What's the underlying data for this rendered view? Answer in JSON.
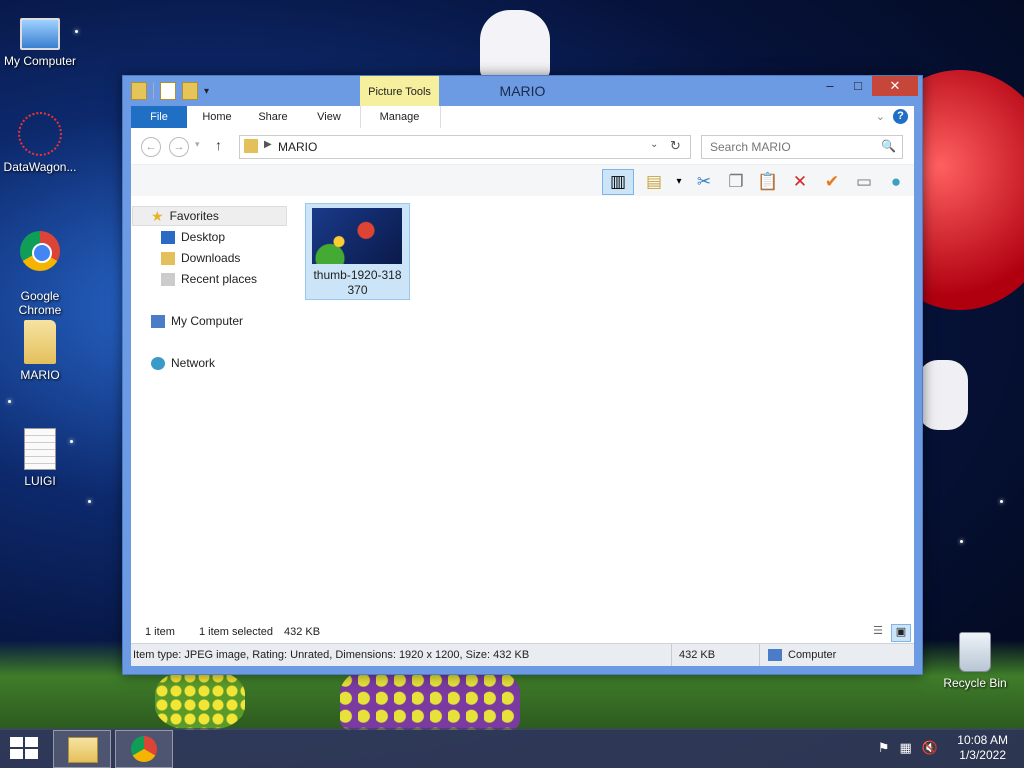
{
  "desktop": {
    "icons": [
      {
        "label": "My Computer",
        "icon": "computer-icon"
      },
      {
        "label": "DataWagon...",
        "icon": "datawagon-icon"
      },
      {
        "label": "Google\nChrome",
        "icon": "chrome-icon"
      },
      {
        "label": "MARIO",
        "icon": "folder-icon"
      },
      {
        "label": "LUIGI",
        "icon": "document-icon"
      },
      {
        "label": "Recycle Bin",
        "icon": "recycle-bin-icon"
      }
    ]
  },
  "window": {
    "title": "MARIO",
    "contextual_tab_group": "Picture Tools",
    "tabs": {
      "file": "File",
      "home": "Home",
      "share": "Share",
      "view": "View",
      "manage": "Manage"
    },
    "buttons": {
      "minimize": "–",
      "maximize": "□",
      "close": "✕"
    },
    "address": {
      "path": "MARIO",
      "back": "←",
      "forward": "→",
      "up": "↑",
      "dropdown": "⌄",
      "refresh": "↻"
    },
    "search": {
      "placeholder": "Search MARIO",
      "icon": "🔍"
    },
    "toolbar_icons": [
      "preview-pane-icon",
      "properties-folder-icon",
      "dropdown-icon",
      "cut-icon",
      "copy-icon",
      "paste-icon",
      "delete-icon",
      "rename-icon",
      "email-icon",
      "shell-icon"
    ],
    "nav": {
      "favorites": "Favorites",
      "desktop": "Desktop",
      "downloads": "Downloads",
      "recent": "Recent places",
      "my_computer": "My Computer",
      "network": "Network"
    },
    "file": {
      "name": "thumb-1920-318\n370"
    },
    "status": {
      "count": "1 item",
      "selected": "1 item selected",
      "size": "432 KB"
    },
    "details": {
      "info": "Item type: JPEG image, Rating: Unrated, Dimensions: 1920 x 1200, Size: 432 KB",
      "size": "432 KB",
      "location": "Computer"
    }
  },
  "taskbar": {
    "apps": [
      "file-explorer-icon",
      "chrome-icon"
    ],
    "time": "10:08 AM",
    "date": "1/3/2022"
  },
  "colors": {
    "ribbon_accent": "#1f6fc5",
    "window_frame": "#6c9be3",
    "selection": "#cce4f7",
    "close_button": "#c7463a",
    "picture_tools": "#f6ef9e"
  }
}
